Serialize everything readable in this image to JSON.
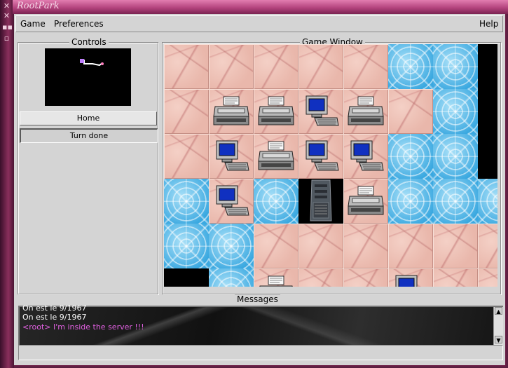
{
  "window": {
    "title": "RootPark"
  },
  "menu": {
    "game": "Game",
    "preferences": "Preferences",
    "help": "Help"
  },
  "controls": {
    "title": "Controls",
    "home_button": "Home",
    "turn_done_button": "Turn done"
  },
  "game_window": {
    "title": "Game Window",
    "rows": [
      [
        "cement",
        "cement",
        "cement",
        "cement",
        "cement",
        "water",
        "water",
        "black"
      ],
      [
        "cement",
        "printer",
        "printer",
        "computer",
        "printer",
        "cement",
        "water",
        "black"
      ],
      [
        "cement",
        "computer",
        "printer",
        "computer",
        "computer",
        "water",
        "water",
        "black"
      ],
      [
        "water",
        "computer",
        "water",
        "server",
        "printer",
        "water",
        "water",
        "water"
      ],
      [
        "water",
        "water",
        "cement",
        "cement",
        "cement",
        "cement",
        "cement",
        "cement"
      ],
      [
        "black",
        "water",
        "printer",
        "cement",
        "cement",
        "computer",
        "cement",
        "cement"
      ]
    ],
    "black_tile_color": "#000000"
  },
  "messages": {
    "title": "Messages",
    "lines": [
      {
        "text": "On est le 9/1967",
        "color": "#ffffff"
      },
      {
        "text": "On est le 9/1967",
        "color": "#ffffff"
      },
      {
        "text": "<root> I'm inside the server !!!",
        "color": "#e060e0"
      }
    ]
  },
  "colors": {
    "accent": "#b4447e",
    "panel": "#d4d4d4"
  }
}
